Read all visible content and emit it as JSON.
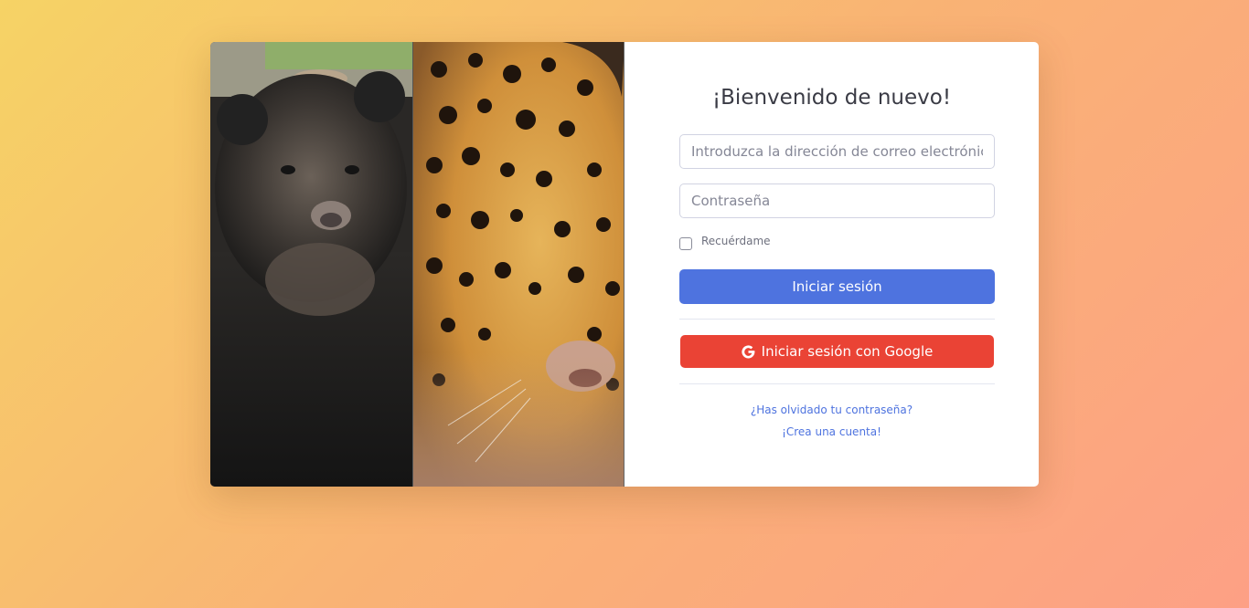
{
  "login": {
    "title": "¡Bienvenido de nuevo!",
    "email_placeholder": "Introduzca la dirección de correo electrónico...",
    "password_placeholder": "Contraseña",
    "remember_label": "Recuérdame",
    "login_button": "Iniciar sesión",
    "google_button": "Iniciar sesión con Google",
    "forgot_link": "¿Has olvidado tu contraseña?",
    "create_link": "¡Crea una cuenta!"
  },
  "images": {
    "left": "spectacled-bear-photo",
    "right": "jaguar-photo"
  },
  "colors": {
    "primary": "#4e73df",
    "google": "#ea4335",
    "gradient_start": "#f6d365",
    "gradient_end": "#fda085"
  }
}
